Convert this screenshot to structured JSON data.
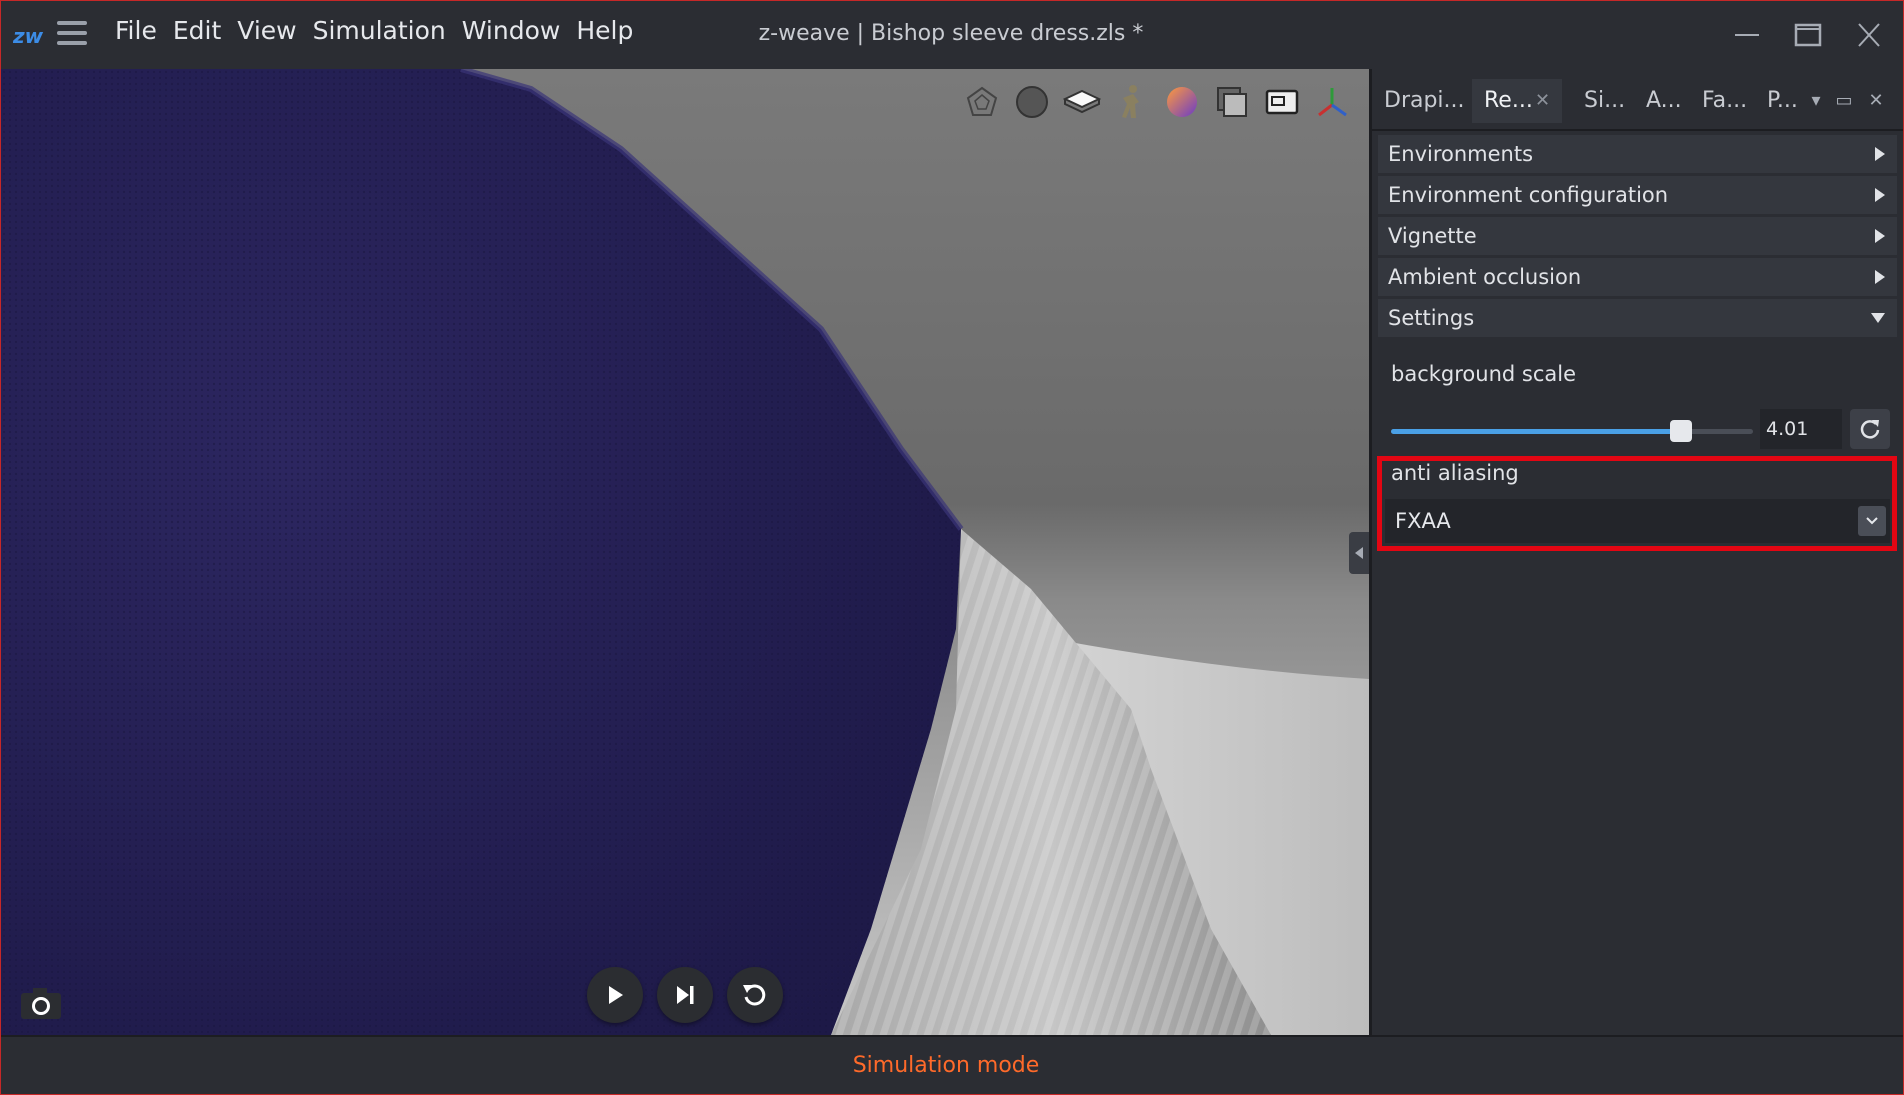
{
  "app": {
    "title": "z-weave | Bishop sleeve dress.zls *",
    "logo": "zw-logo",
    "menu": [
      "File",
      "Edit",
      "View",
      "Simulation",
      "Window",
      "Help"
    ],
    "window_controls": [
      "minimize-icon",
      "maximize-icon",
      "close-icon"
    ]
  },
  "viewport": {
    "tool_icons": [
      "polygon-icon",
      "sphere-icon",
      "plane-icon",
      "avatar-icon",
      "gradient-sphere-icon",
      "layers-icon",
      "sewing-machine-icon",
      "axes-icon"
    ],
    "playback_icons": [
      "play-icon",
      "step-forward-icon",
      "reset-icon"
    ],
    "camera_icon": "camera-icon",
    "colors": {
      "fabric": "#262154",
      "sleeve": "#b7b7b7",
      "background": "#6f6f6f"
    }
  },
  "panel": {
    "tabs": [
      "Drapi...",
      "Re...",
      "Si...",
      "A...",
      "Fa...",
      "P..."
    ],
    "active_tab_index": 1,
    "sections": [
      {
        "label": "Environments",
        "expanded": false
      },
      {
        "label": "Environment configuration",
        "expanded": false
      },
      {
        "label": "Vignette",
        "expanded": false
      },
      {
        "label": "Ambient occlusion",
        "expanded": false
      },
      {
        "label": "Settings",
        "expanded": true
      }
    ],
    "settings": {
      "background_scale_label": "background scale",
      "background_scale_value": "4.01",
      "background_scale_fraction": 0.8,
      "anti_aliasing_label": "anti aliasing",
      "anti_aliasing_value": "FXAA"
    },
    "accent": "#4aa0e6",
    "highlight_color": "#e30613"
  },
  "status": {
    "text": "Simulation mode",
    "color": "#ff6a2a"
  }
}
